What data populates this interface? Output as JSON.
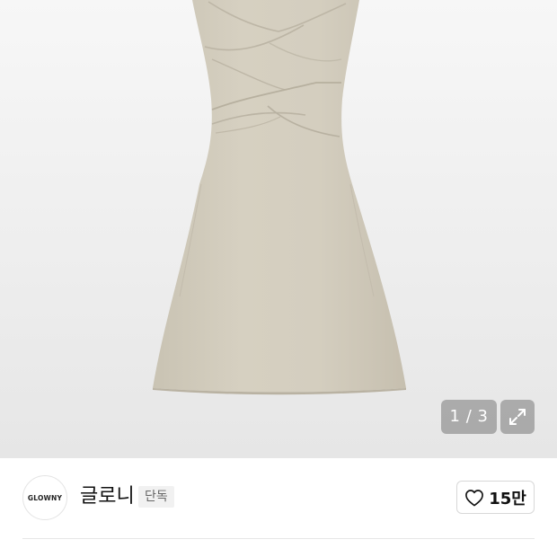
{
  "gallery": {
    "pager_text": "1 / 3",
    "current_page": 1,
    "total_pages": 3
  },
  "brand": {
    "logo_text": "GLOWNY",
    "name": "글로니",
    "exclusive_badge": "단독"
  },
  "like": {
    "count": "15만",
    "icon": "heart-outline-icon"
  },
  "colors": {
    "dress": "#d1cbbc",
    "pager_bg": "#7a7a7a",
    "divider": "#e6e6e6"
  }
}
